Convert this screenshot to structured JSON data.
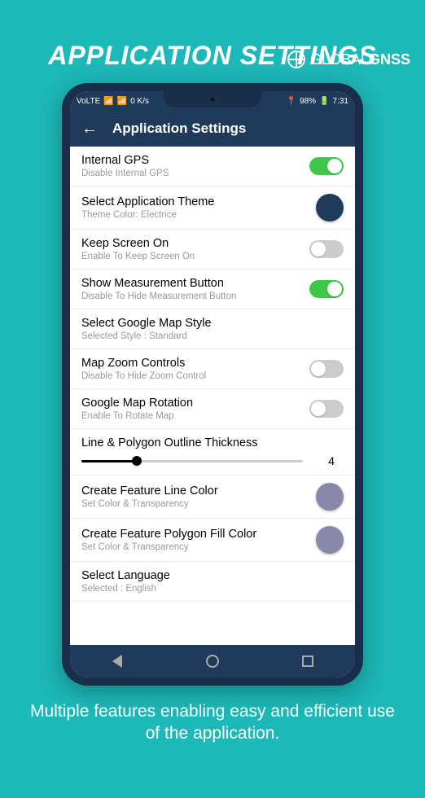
{
  "brand": {
    "prefix": "GLOBAL",
    "suffix": "GNSS"
  },
  "page_title": "APPLICATION SETTINGS",
  "statusbar": {
    "left": "VoLTE",
    "speed": "0 K/s",
    "battery": "98%",
    "time": "7:31"
  },
  "appbar": {
    "title": "Application Settings"
  },
  "settings": [
    {
      "title": "Internal GPS",
      "sub": "Disable Internal GPS",
      "type": "toggle",
      "on": true
    },
    {
      "title": "Select Application Theme",
      "sub": "Theme Color: Electrice",
      "type": "color",
      "color": "#1f3a5a"
    },
    {
      "title": "Keep Screen On",
      "sub": "Enable To Keep Screen On",
      "type": "toggle",
      "on": false
    },
    {
      "title": "Show Measurement Button",
      "sub": "Disable To Hide Measurement Button",
      "type": "toggle",
      "on": true
    },
    {
      "title": "Select Google Map Style",
      "sub": "Selected Style : Standard",
      "type": "none"
    },
    {
      "title": "Map Zoom Controls",
      "sub": "Disable To Hide Zoom Control",
      "type": "toggle",
      "on": false
    },
    {
      "title": "Google Map Rotation",
      "sub": "Enable To Rotate Map",
      "type": "toggle",
      "on": false
    },
    {
      "title": "Line & Polygon Outline Thickness",
      "sub": "",
      "type": "slider",
      "value": "4"
    },
    {
      "title": "Create Feature Line Color",
      "sub": "Set Color & Transparency",
      "type": "color",
      "color": "#8888aa"
    },
    {
      "title": "Create Feature Polygon Fill Color",
      "sub": "Set Color & Transparency",
      "type": "color",
      "color": "#8888aa"
    },
    {
      "title": "Select Language",
      "sub": "Selected : English",
      "type": "none"
    }
  ],
  "footer": "Multiple features enabling easy and efficient use of the application."
}
